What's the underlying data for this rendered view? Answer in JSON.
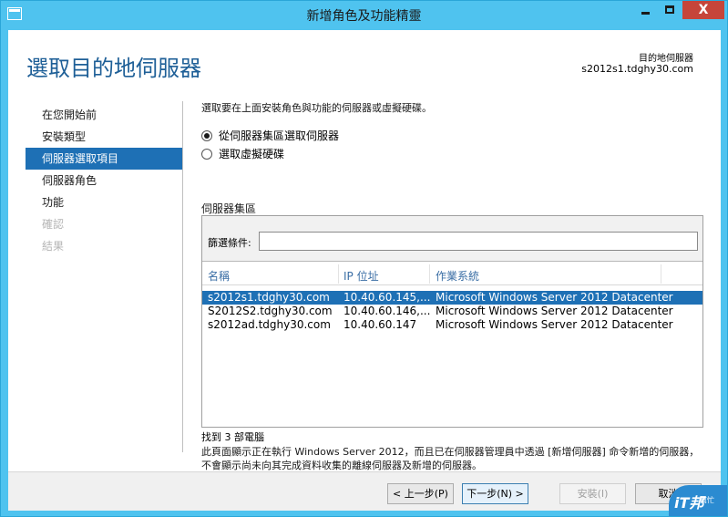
{
  "window": {
    "title": "新增角色及功能精靈",
    "close_glyph": "X"
  },
  "header": {
    "page_title": "選取目的地伺服器",
    "destination_label": "目的地伺服器",
    "destination_server": "s2012s1.tdghy30.com"
  },
  "nav": {
    "items": [
      {
        "label": "在您開始前",
        "state": "normal"
      },
      {
        "label": "安裝類型",
        "state": "normal"
      },
      {
        "label": "伺服器選取項目",
        "state": "selected"
      },
      {
        "label": "伺服器角色",
        "state": "normal"
      },
      {
        "label": "功能",
        "state": "normal"
      },
      {
        "label": "確認",
        "state": "disabled"
      },
      {
        "label": "結果",
        "state": "disabled"
      }
    ]
  },
  "main": {
    "instruction": "選取要在上面安裝角色與功能的伺服器或虛擬硬碟。",
    "options": [
      {
        "label": "從伺服器集區選取伺服器",
        "selected": true
      },
      {
        "label": "選取虛擬硬碟",
        "selected": false
      }
    ],
    "pool_label": "伺服器集區",
    "filter_label": "篩選條件:",
    "filter_value": "",
    "columns": [
      "名稱",
      "IP 位址",
      "作業系統"
    ],
    "rows": [
      {
        "name": "s2012s1.tdghy30.com",
        "ip": "10.40.60.145,...",
        "os": "Microsoft Windows Server 2012 Datacenter",
        "selected": true
      },
      {
        "name": "S2012S2.tdghy30.com",
        "ip": "10.40.60.146,...",
        "os": "Microsoft Windows Server 2012 Datacenter",
        "selected": false
      },
      {
        "name": "s2012ad.tdghy30.com",
        "ip": "10.40.60.147",
        "os": "Microsoft Windows Server 2012 Datacenter",
        "selected": false
      }
    ],
    "found_text": "找到 3 部電腦",
    "note": "此頁面顯示正在執行 Windows Server 2012，而且已在伺服器管理員中透過 [新增伺服器] 命令新增的伺服器，不會顯示尚未向其完成資料收集的離線伺服器及新增的伺服器。"
  },
  "footer": {
    "prev_label": "< 上一步(P)",
    "next_label": "下一步(N) >",
    "install_label": "安裝(I)",
    "cancel_label": "取消"
  },
  "badge": {
    "brand": "iT邦",
    "sub": "幫忙"
  },
  "colors": {
    "title_bar": "#4fc3ef",
    "header_text": "#1e5f97",
    "selection": "#1e70b5",
    "close_button": "#c6453a"
  }
}
